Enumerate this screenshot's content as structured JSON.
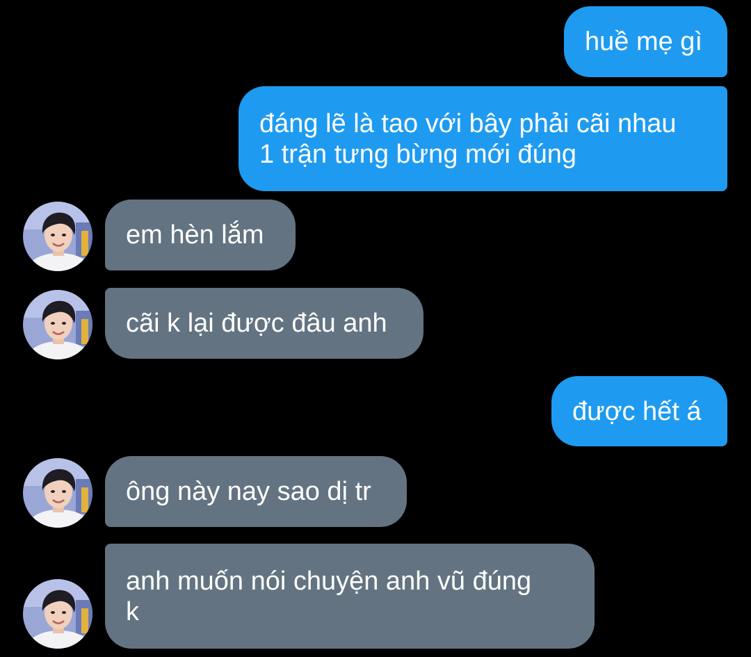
{
  "conversation": {
    "messages": [
      {
        "direction": "outgoing",
        "lines": [
          "huề mẹ gì"
        ]
      },
      {
        "direction": "outgoing",
        "lines": [
          "đáng lẽ là tao với bây phải cãi nhau",
          "1 trận tưng bừng mới đúng"
        ]
      },
      {
        "direction": "incoming",
        "lines": [
          "em hèn lắm"
        ]
      },
      {
        "direction": "incoming",
        "lines": [
          "cãi k lại được đâu anh"
        ]
      },
      {
        "direction": "outgoing",
        "lines": [
          "được hết á"
        ]
      },
      {
        "direction": "incoming",
        "lines": [
          "ông này nay sao dị tr"
        ]
      },
      {
        "direction": "incoming",
        "lines": [
          "anh muốn nói chuyện anh vũ đúng",
          "k"
        ]
      }
    ]
  },
  "colors": {
    "background": "#000000",
    "outgoing_bubble": "#1e9bf0",
    "incoming_bubble": "#637381",
    "text": "#ffffff"
  },
  "icons": {
    "contact_avatar": "avatar-photo"
  }
}
